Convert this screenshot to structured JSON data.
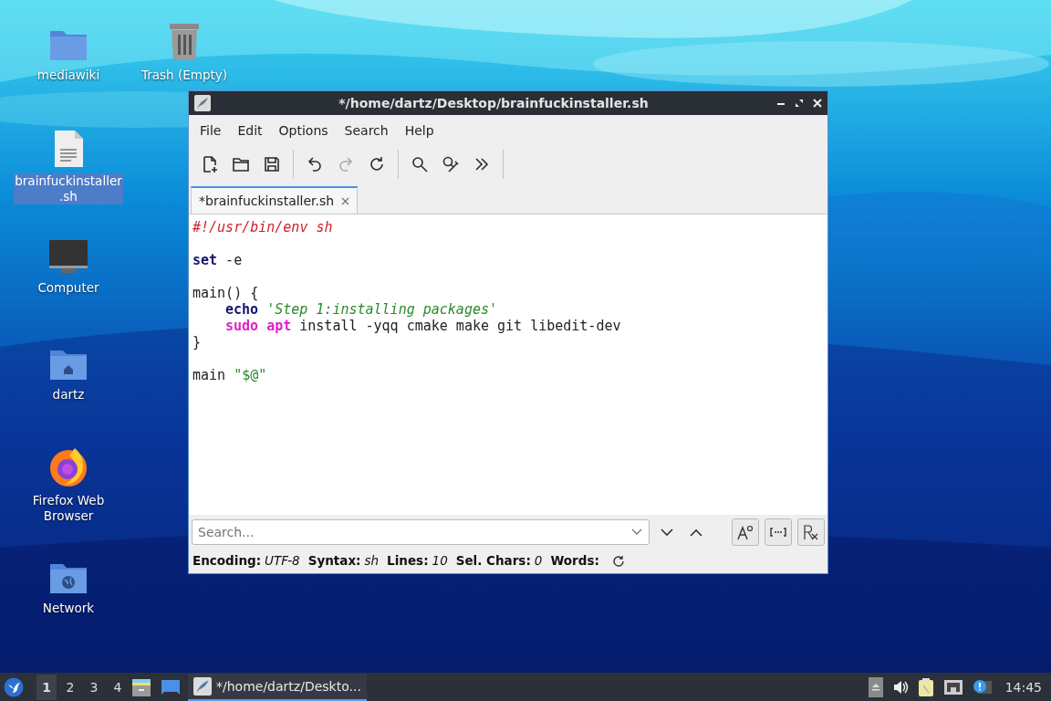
{
  "desktop_icons": [
    {
      "label": "mediawiki",
      "kind": "folder",
      "selected": false
    },
    {
      "label": "Trash (Empty)",
      "kind": "trash",
      "selected": false
    },
    {
      "label": "brainfuckinstaller.sh",
      "kind": "file",
      "selected": true
    },
    {
      "label": "Computer",
      "kind": "computer",
      "selected": false
    },
    {
      "label": "dartz",
      "kind": "home",
      "selected": false
    },
    {
      "label": "Firefox Web Browser",
      "kind": "browser",
      "selected": false
    },
    {
      "label": "Network",
      "kind": "network",
      "selected": false
    }
  ],
  "window": {
    "title": "*/home/dartz/Desktop/brainfuckinstaller.sh",
    "menu": [
      "File",
      "Edit",
      "Options",
      "Search",
      "Help"
    ],
    "toolbar": [
      {
        "kind": "new",
        "disabled": false
      },
      {
        "kind": "open",
        "disabled": false
      },
      {
        "kind": "save",
        "disabled": false
      },
      {
        "kind": "separator"
      },
      {
        "kind": "undo",
        "disabled": false
      },
      {
        "kind": "redo",
        "disabled": true
      },
      {
        "kind": "reload",
        "disabled": false
      },
      {
        "kind": "separator"
      },
      {
        "kind": "find",
        "disabled": false
      },
      {
        "kind": "replace",
        "disabled": false
      },
      {
        "kind": "more",
        "disabled": false
      },
      {
        "kind": "separator"
      }
    ],
    "tabs": [
      {
        "label": "*brainfuckinstaller.sh",
        "selected": true
      }
    ],
    "lines": [
      {
        "kind": "code",
        "tokens": [
          {
            "text": "#!/usr/bin/env sh",
            "kind": "comment"
          }
        ]
      },
      {
        "kind": "blank"
      },
      {
        "kind": "code",
        "tokens": [
          {
            "text": "set",
            "kind": "keyword"
          },
          {
            "text": " -e",
            "kind": "plain"
          }
        ]
      },
      {
        "kind": "blank"
      },
      {
        "kind": "code",
        "tokens": [
          {
            "text": "main() {",
            "kind": "plain"
          }
        ]
      },
      {
        "kind": "indented",
        "tokens": [
          {
            "text": "echo",
            "kind": "keyword"
          },
          {
            "text": " 'Step 1:installing packages'",
            "kind": "string"
          }
        ]
      },
      {
        "kind": "indented",
        "tokens": [
          {
            "text": "sudo apt",
            "kind": "command"
          },
          {
            "text": " install -yqq cmake make git libedit-dev",
            "kind": "plain"
          }
        ]
      },
      {
        "kind": "code",
        "tokens": [
          {
            "text": "}",
            "kind": "plain"
          }
        ]
      },
      {
        "kind": "blank"
      },
      {
        "kind": "code",
        "tokens": [
          {
            "text": "main ",
            "kind": "plain"
          },
          {
            "text": "\"$@\"",
            "kind": "quoted"
          }
        ]
      }
    ],
    "search": {
      "placeholder": "Search..."
    },
    "search_options": [
      {
        "kind": "case",
        "on": false
      },
      {
        "kind": "word",
        "on": false
      },
      {
        "kind": "regex",
        "on": false
      }
    ],
    "status": [
      {
        "label": "Encoding:",
        "value": "UTF-8"
      },
      {
        "label": "Syntax:",
        "value": "sh"
      },
      {
        "label": "Lines:",
        "value": "10"
      },
      {
        "label": "Sel. Chars:",
        "value": "0"
      },
      {
        "label": "Words:"
      }
    ]
  },
  "taskbar": {
    "workspaces": [
      {
        "label": "1",
        "selected": true
      },
      {
        "label": "2",
        "selected": false
      },
      {
        "label": "3",
        "selected": false
      },
      {
        "label": "4",
        "selected": false
      }
    ],
    "tasks": [
      {
        "title": "*/home/dartz/Deskto...",
        "selected": true
      }
    ],
    "clock": "14:45"
  }
}
